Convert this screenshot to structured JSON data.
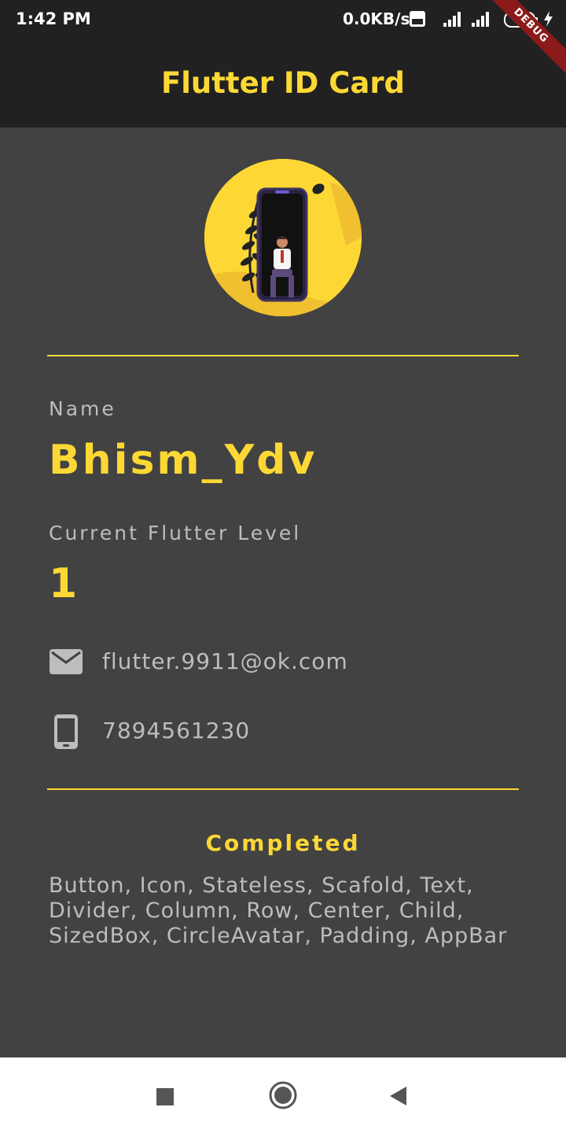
{
  "status_bar": {
    "time": "1:42 PM",
    "network_speed": "0.0KB/s",
    "volte_icon": "volte-icon",
    "signal_icon_1": "signal-4g-icon",
    "signal_icon_2": "signal-icon",
    "battery_level": "84",
    "debug_banner": "DEBUG"
  },
  "app_bar": {
    "title": "Flutter ID Card"
  },
  "profile": {
    "name_label": "Name",
    "name_value": "Bhism_Ydv",
    "level_label": "Current Flutter Level",
    "level_value": "1",
    "email": "flutter.9911@ok.com",
    "phone": "7894561230"
  },
  "completed": {
    "title": "Completed",
    "list": "Button, Icon, Stateless, Scafold, Text, Divider, Column, Row, Center, Child, SizedBox, CircleAvatar, Padding, AppBar"
  },
  "colors": {
    "accent": "#fdd835",
    "background": "#424242",
    "app_bar": "#212121",
    "muted_text": "#bdbdbd"
  },
  "nav_bar": {
    "recents_icon": "square-icon",
    "home_icon": "circle-icon",
    "back_icon": "triangle-back-icon"
  }
}
